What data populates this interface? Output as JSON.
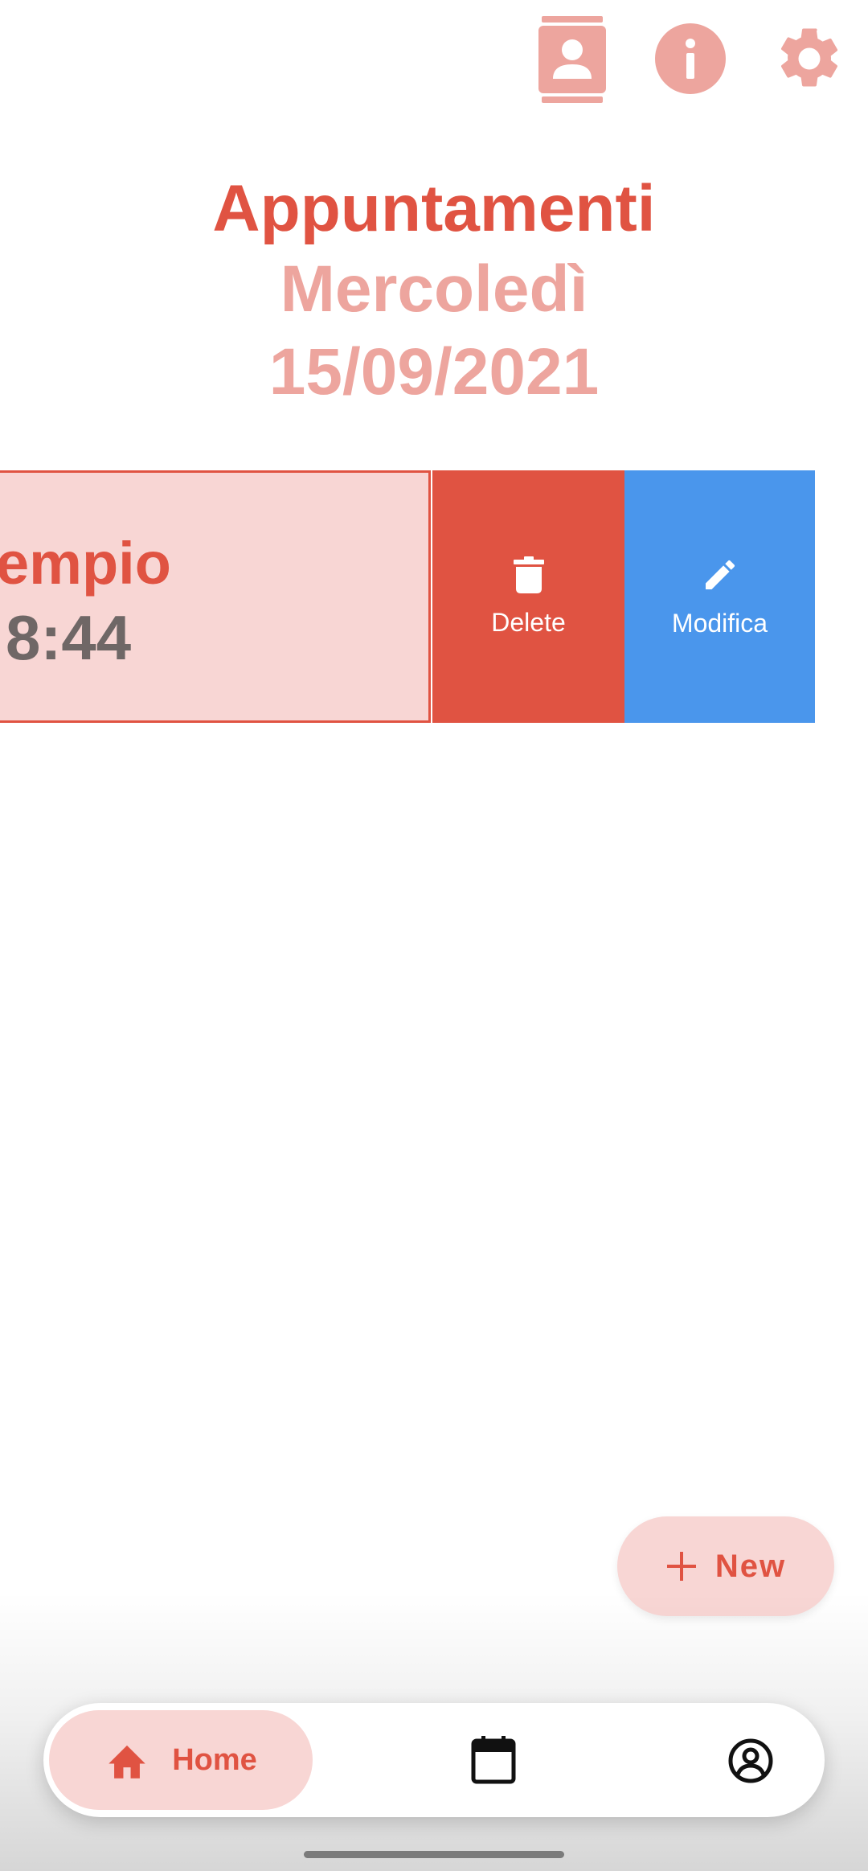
{
  "header": {
    "icons": [
      "contacts-icon",
      "info-icon",
      "settings-icon"
    ],
    "title": "Appuntamenti",
    "weekday": "Mercoledì",
    "date": "15/09/2021"
  },
  "appointment": {
    "title": "empio",
    "time": "8:44"
  },
  "swipe_actions": {
    "delete_label": "Delete",
    "edit_label": "Modifica"
  },
  "fab": {
    "label": "New",
    "icon": "plus-icon"
  },
  "bottom_nav": {
    "home_label": "Home",
    "items": [
      "home-icon",
      "calendar-icon",
      "account-icon"
    ]
  },
  "colors": {
    "accent": "#e05342",
    "accent_light": "#eda59e",
    "card_bg": "#f8d6d4",
    "edit_blue": "#4a96ec",
    "time_gray": "#6f6766"
  }
}
